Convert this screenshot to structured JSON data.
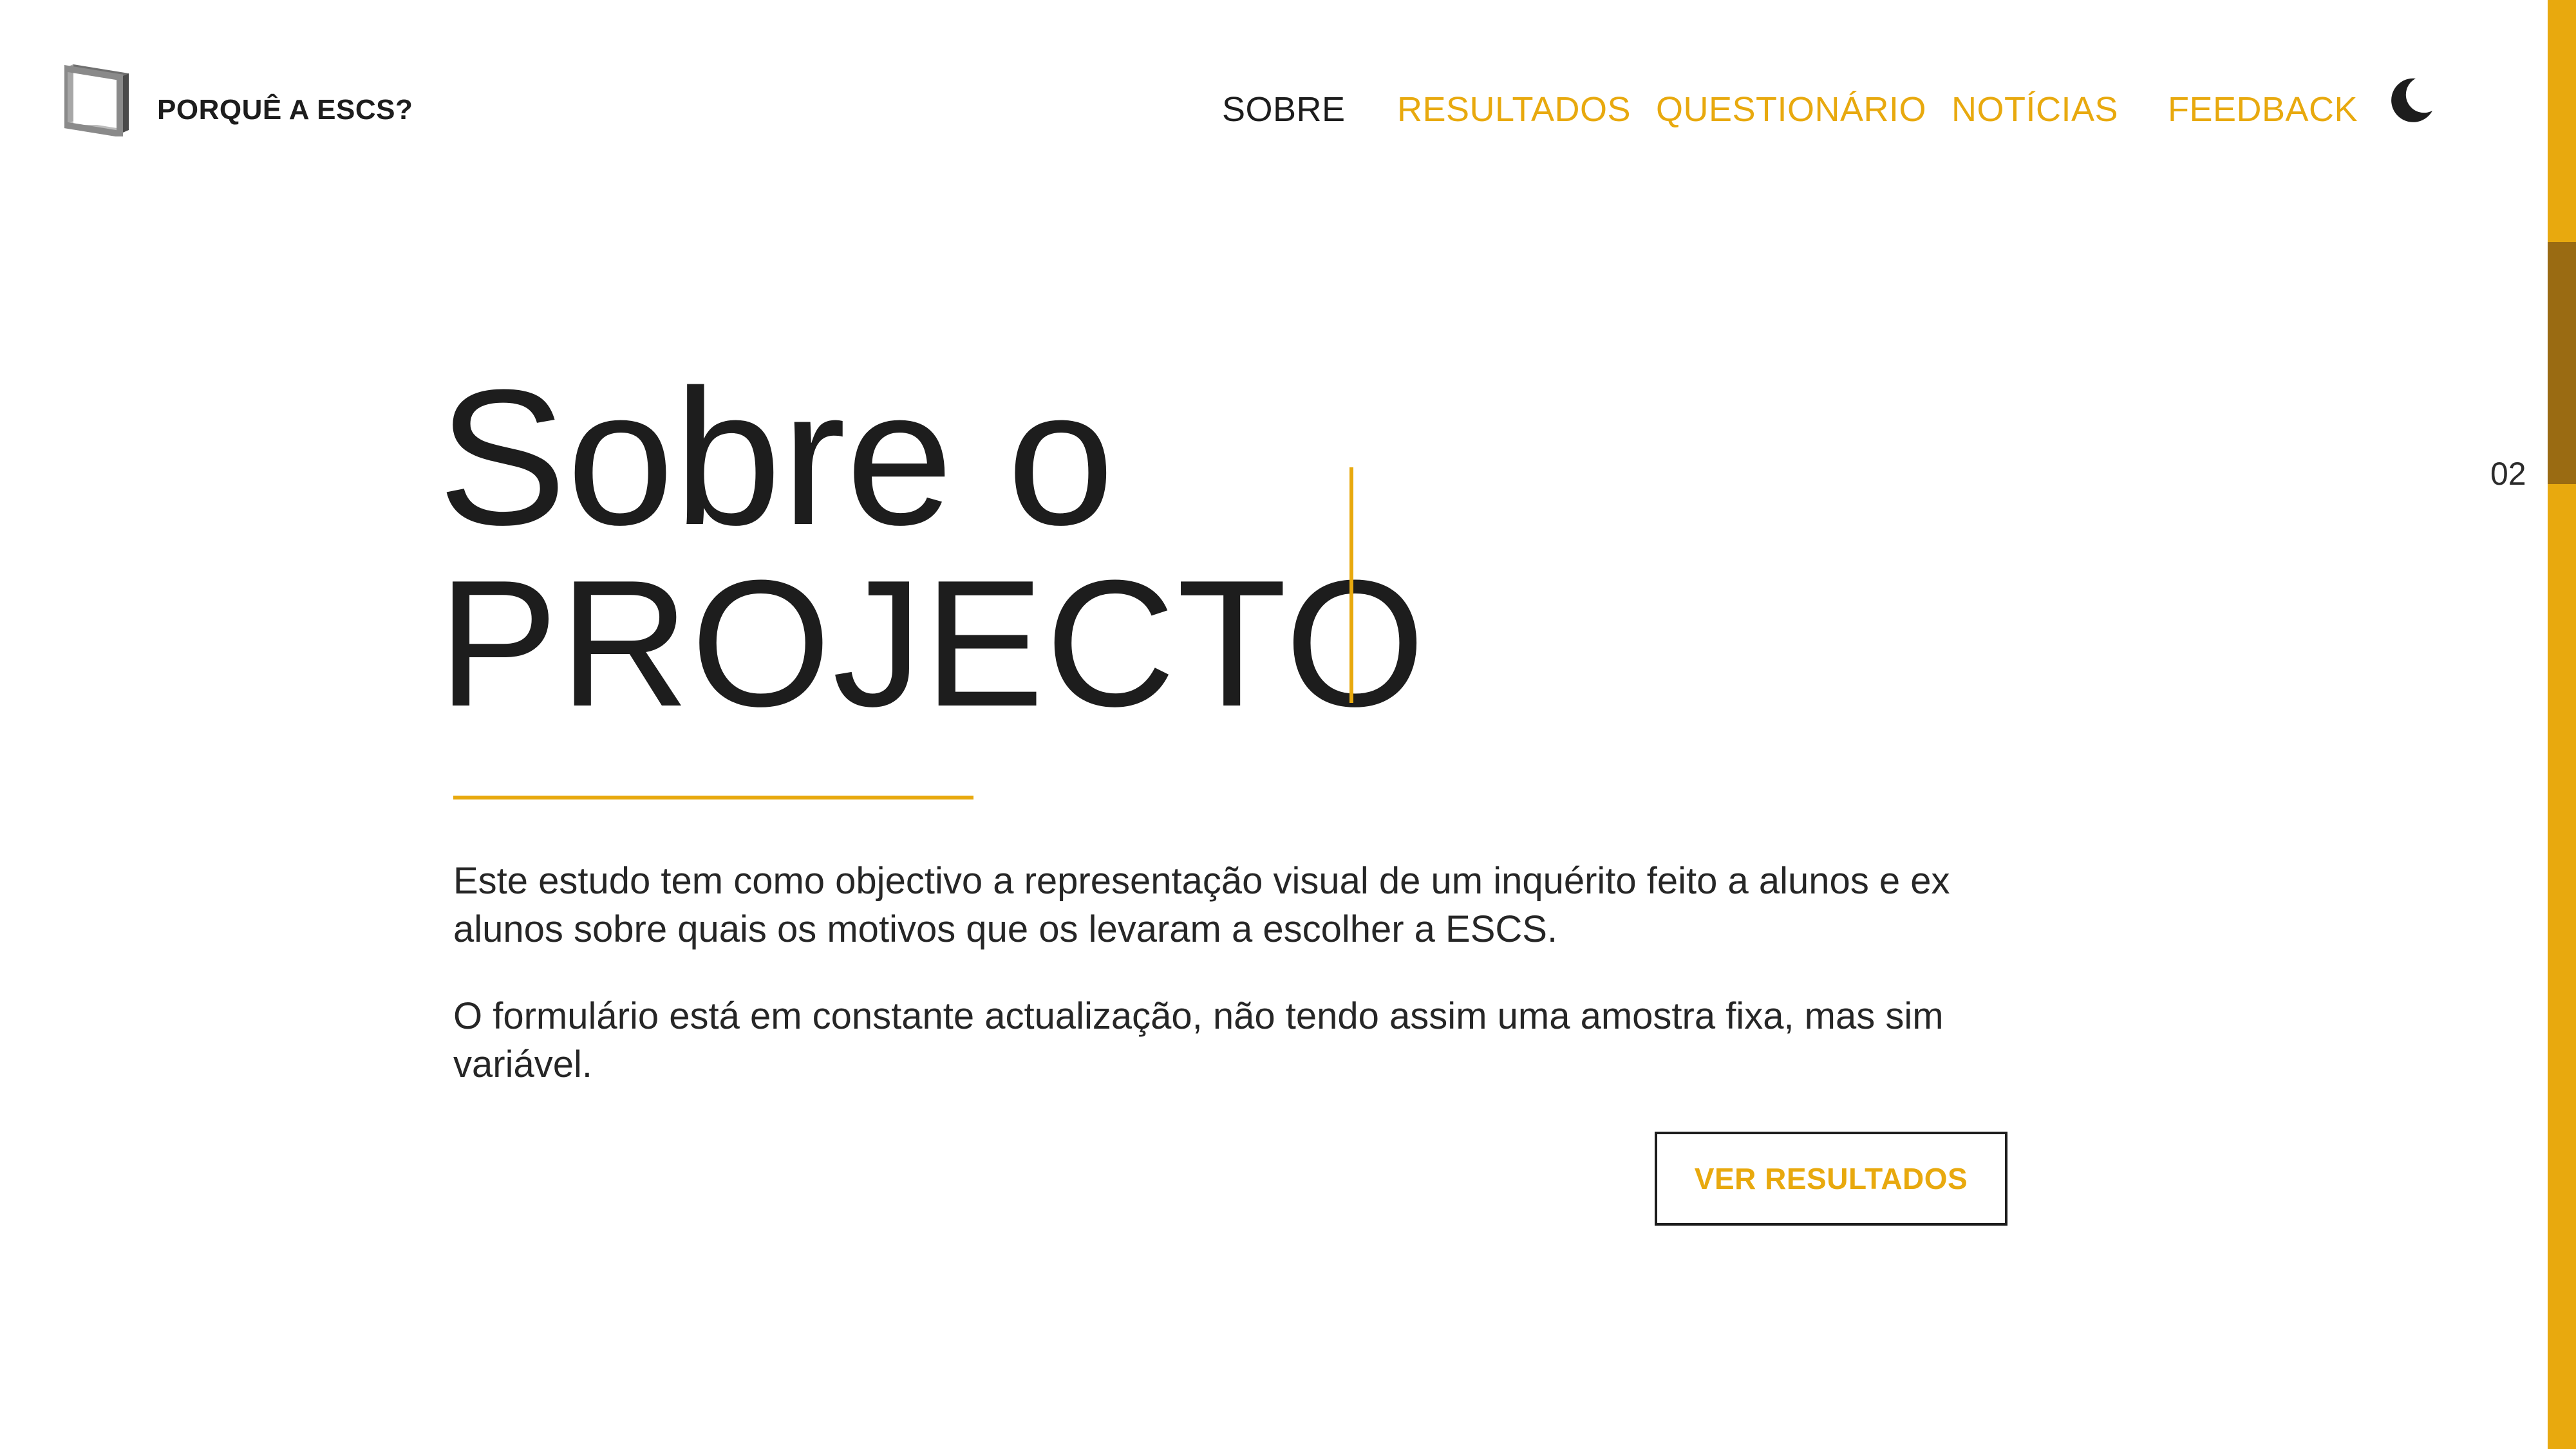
{
  "header": {
    "brand": "PORQUÊ A ESCS?",
    "logo_icon": "cube-logo-icon",
    "theme_toggle_icon": "moon-icon"
  },
  "nav": {
    "items": [
      {
        "label": "SOBRE",
        "active": true
      },
      {
        "label": "RESULTADOS",
        "active": false
      },
      {
        "label": "QUESTIONÁRIO",
        "active": false
      },
      {
        "label": "NOTÍCIAS",
        "active": false
      },
      {
        "label": "FEEDBACK",
        "active": false
      }
    ]
  },
  "hero": {
    "title_line1": "Sobre o",
    "title_line2": "PROJECTO",
    "paragraphs": [
      "Este estudo tem como objectivo a representação visual de um inquérito feito a alunos e ex alunos sobre quais os motivos que os levaram a escolher a ESCS.",
      "O formulário está em constante actualização, não tendo assim uma amostra fixa, mas sim variável."
    ],
    "cta_label": "VER RESULTADOS"
  },
  "section_indicator": "02",
  "colors": {
    "accent": "#e8a90e",
    "text": "#1d1d1d",
    "rail_thumb": "#9a6b12",
    "background": "#ffffff"
  }
}
